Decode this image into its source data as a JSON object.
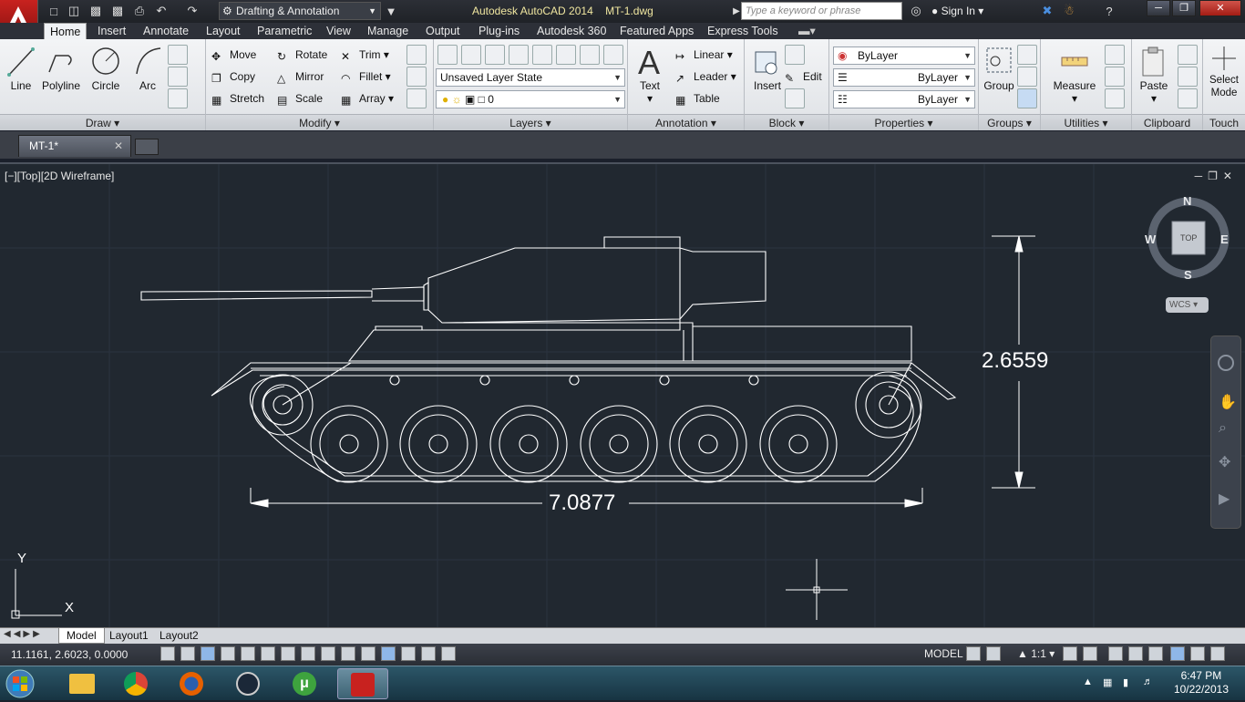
{
  "app": {
    "title": "Autodesk AutoCAD 2014",
    "filename": "MT-1.dwg",
    "workspace": "Drafting & Annotation",
    "search_placeholder": "Type a keyword or phrase",
    "sign_in": "Sign In"
  },
  "ribbon_tabs": [
    "Home",
    "Insert",
    "Annotate",
    "Layout",
    "Parametric",
    "View",
    "Manage",
    "Output",
    "Plug-ins",
    "Autodesk 360",
    "Featured Apps",
    "Express Tools"
  ],
  "draw": {
    "title": "Draw",
    "line": "Line",
    "polyline": "Polyline",
    "circle": "Circle",
    "arc": "Arc"
  },
  "modify": {
    "title": "Modify",
    "move": "Move",
    "rotate": "Rotate",
    "trim": "Trim",
    "copy": "Copy",
    "mirror": "Mirror",
    "fillet": "Fillet",
    "stretch": "Stretch",
    "scale": "Scale",
    "array": "Array"
  },
  "layers": {
    "title": "Layers",
    "layer_state": "Unsaved Layer State",
    "current_layer": "0"
  },
  "annotation": {
    "title": "Annotation",
    "text": "Text",
    "linear": "Linear",
    "leader": "Leader",
    "table": "Table"
  },
  "block": {
    "title": "Block",
    "insert": "Insert",
    "edit": "Edit"
  },
  "properties": {
    "title": "Properties",
    "color": "ByLayer",
    "linetype": "ByLayer",
    "lineweight": "ByLayer"
  },
  "groups": {
    "title": "Groups",
    "group": "Group"
  },
  "utilities": {
    "title": "Utilities",
    "measure": "Measure"
  },
  "clipboard": {
    "title": "Clipboard",
    "paste": "Paste"
  },
  "touch": {
    "title": "Touch",
    "select_mode": "Select Mode"
  },
  "document_tab": "MT-1*",
  "viewport": {
    "label": "[−][Top][2D Wireframe]",
    "dim_height": "2.6559",
    "dim_width": "7.0877",
    "viewcube": {
      "north": "N",
      "south": "S",
      "east": "E",
      "west": "W",
      "face": "TOP"
    },
    "wcs": "WCS",
    "ucs_x": "X",
    "ucs_y": "Y"
  },
  "layout_tabs": [
    "Model",
    "Layout1",
    "Layout2"
  ],
  "status": {
    "coords": "11.1161, 2.6023, 0.0000",
    "model": "MODEL",
    "scale": "1:1"
  },
  "taskbar": {
    "time": "6:47 PM",
    "date": "10/22/2013"
  }
}
